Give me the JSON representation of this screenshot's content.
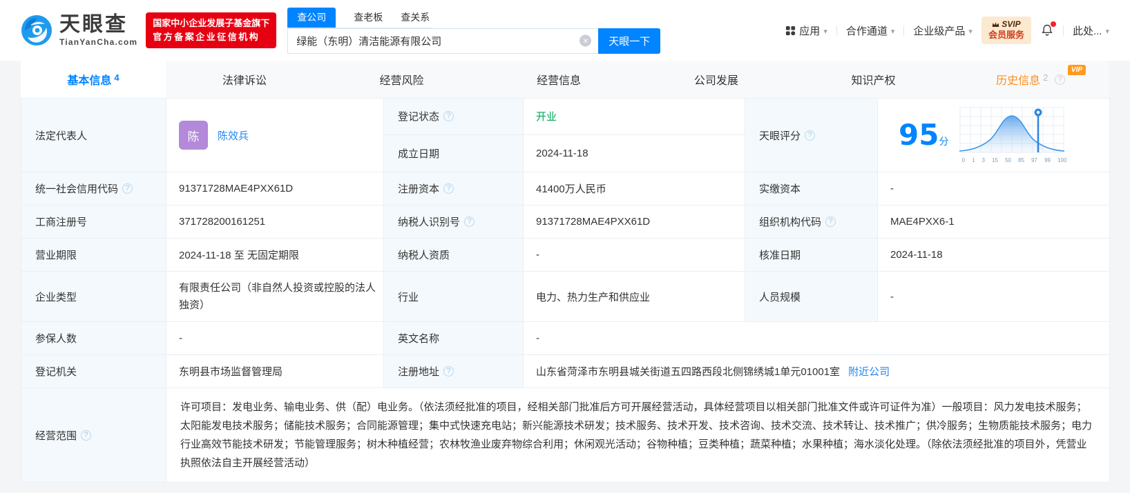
{
  "header": {
    "logo": {
      "title": "天眼查",
      "domain": "TianYanCha.com"
    },
    "cert_badge": {
      "line1": "国家中小企业发展子基金旗下",
      "line2": "官方备案企业征信机构"
    },
    "search": {
      "tabs": [
        {
          "label": "查公司",
          "active": true
        },
        {
          "label": "查老板",
          "active": false
        },
        {
          "label": "查关系",
          "active": false
        }
      ],
      "input_value": "绿能（东明）清洁能源有限公司",
      "search_button": "天眼一下"
    },
    "nav": {
      "app": "应用",
      "channel": "合作通道",
      "enterprise": "企业级产品",
      "svip_line1": "SVIP",
      "svip_line2": "会员服务",
      "user": "此处..."
    }
  },
  "tabs": [
    {
      "label": "基本信息",
      "count": "4",
      "active": true
    },
    {
      "label": "法律诉讼"
    },
    {
      "label": "经营风险"
    },
    {
      "label": "经营信息"
    },
    {
      "label": "公司发展"
    },
    {
      "label": "知识产权"
    },
    {
      "label": "历史信息",
      "count": "2",
      "vip_tag": "VIP"
    }
  ],
  "info": {
    "legal_rep_label": "法定代表人",
    "legal_rep_avatar": "陈",
    "legal_rep_name": "陈效兵",
    "reg_status_label": "登记状态",
    "reg_status": "开业",
    "establish_date_label": "成立日期",
    "establish_date": "2024-11-18",
    "score_label": "天眼评分",
    "score": "95",
    "score_unit": "分",
    "credit_code_label": "统一社会信用代码",
    "credit_code": "91371728MAE4PXX61D",
    "reg_capital_label": "注册资本",
    "reg_capital": "41400万人民币",
    "paid_capital_label": "实缴资本",
    "paid_capital": "-",
    "reg_number_label": "工商注册号",
    "reg_number": "371728200161251",
    "taxpayer_id_label": "纳税人识别号",
    "taxpayer_id": "91371728MAE4PXX61D",
    "org_code_label": "组织机构代码",
    "org_code": "MAE4PXX6-1",
    "business_term_label": "营业期限",
    "business_term": "2024-11-18 至 无固定期限",
    "taxpayer_quality_label": "纳税人资质",
    "taxpayer_quality": "-",
    "approval_date_label": "核准日期",
    "approval_date": "2024-11-18",
    "company_type_label": "企业类型",
    "company_type": "有限责任公司（非自然人投资或控股的法人独资）",
    "industry_label": "行业",
    "industry": "电力、热力生产和供应业",
    "staff_size_label": "人员规模",
    "staff_size": "-",
    "insured_label": "参保人数",
    "insured": "-",
    "english_name_label": "英文名称",
    "english_name": "-",
    "reg_authority_label": "登记机关",
    "reg_authority": "东明县市场监督管理局",
    "reg_address_label": "注册地址",
    "reg_address": "山东省菏泽市东明县城关街道五四路西段北侧锦绣城1单元01001室",
    "nearby_link": "附近公司",
    "business_scope_label": "经营范围",
    "business_scope": "许可项目：发电业务、输电业务、供（配）电业务。（依法须经批准的项目，经相关部门批准后方可开展经营活动，具体经营项目以相关部门批准文件或许可证件为准）一般项目：风力发电技术服务；太阳能发电技术服务；储能技术服务；合同能源管理；集中式快速充电站；新兴能源技术研发；技术服务、技术开发、技术咨询、技术交流、技术转让、技术推广；供冷服务；生物质能技术服务；电力行业高效节能技术研发；节能管理服务；树木种植经营；农林牧渔业废弃物综合利用；休闲观光活动；谷物种植；豆类种植；蔬菜种植；水果种植；海水淡化处理。（除依法须经批准的项目外，凭营业执照依法自主开展经营活动）"
  },
  "score_chart": {
    "type": "area",
    "title": "天眼评分",
    "score": 95,
    "unit": "分",
    "x_ticks": [
      0,
      1,
      3,
      15,
      50,
      85,
      97,
      99,
      100
    ],
    "marker_tick": 97,
    "curve": "bell"
  },
  "colors": {
    "accent_blue": "#0084ff",
    "link_blue": "#2086ee",
    "status_green": "#00a854",
    "history_orange": "#ff8d1a",
    "badge_red": "#e60012",
    "avatar_purple": "#b389d9"
  }
}
